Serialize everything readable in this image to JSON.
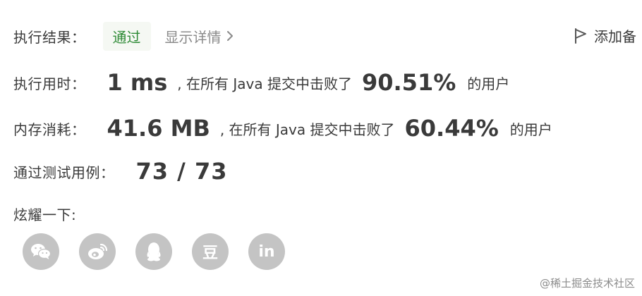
{
  "result": {
    "label": "执行结果：",
    "status": "通过",
    "details_link": "显示详情",
    "add_note": "添加备"
  },
  "runtime": {
    "label": "执行用时：",
    "value": "1 ms",
    "middle_text": ", 在所有 Java 提交中击败了",
    "percent": "90.51%",
    "tail_text": "的用户"
  },
  "memory": {
    "label": "内存消耗：",
    "value": "41.6 MB",
    "middle_text": ", 在所有 Java 提交中击败了",
    "percent": "60.44%",
    "tail_text": "的用户"
  },
  "tests": {
    "label": "通过测试用例：",
    "value": "73 / 73"
  },
  "share": {
    "label": "炫耀一下:",
    "icons": [
      "wechat-icon",
      "weibo-icon",
      "qq-icon",
      "douban-icon",
      "linkedin-icon"
    ],
    "douban_glyph": "豆",
    "linkedin_glyph": "in"
  },
  "watermark": "@稀土掘金技术社区",
  "colors": {
    "success": "#2d8a35",
    "share_icon_bg": "#c4c4c4",
    "muted": "#8a8a8a"
  }
}
